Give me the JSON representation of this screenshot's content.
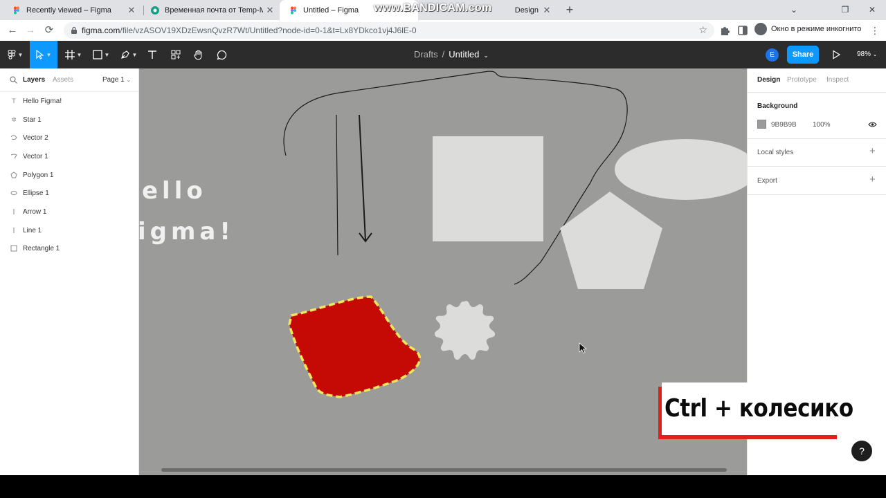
{
  "browser": {
    "tabs": [
      {
        "title": "Recently viewed – Figma",
        "active": false
      },
      {
        "title": "Временная почта от Temp-Mail",
        "active": false
      },
      {
        "title": "Untitled – Figma",
        "active": true
      },
      {
        "title": "Design",
        "active": false
      }
    ],
    "watermark": "www.BANDICAM.com",
    "url_host": "figma.com",
    "url_path": "/file/vzASOV19XDzEwsnQvzR7Wt/Untitled?node-id=0-1&t=Lx8YDkco1vj4J6lE-0",
    "incognito_label": "Окно в режиме инкогнито"
  },
  "figma": {
    "breadcrumb_parent": "Drafts",
    "file_name": "Untitled",
    "avatar_initial": "E",
    "share_label": "Share",
    "zoom_label": "98%"
  },
  "left_panel": {
    "tabs": [
      "Layers",
      "Assets"
    ],
    "page_label": "Page 1",
    "layers": [
      {
        "name": "Hello Figma!",
        "icon": "text-icon"
      },
      {
        "name": "Star 1",
        "icon": "star-icon"
      },
      {
        "name": "Vector 2",
        "icon": "vector-icon"
      },
      {
        "name": "Vector 1",
        "icon": "vector-icon"
      },
      {
        "name": "Polygon 1",
        "icon": "polygon-icon"
      },
      {
        "name": "Ellipse 1",
        "icon": "ellipse-icon"
      },
      {
        "name": "Arrow 1",
        "icon": "arrow-icon"
      },
      {
        "name": "Line 1",
        "icon": "line-icon"
      },
      {
        "name": "Rectangle 1",
        "icon": "rectangle-icon"
      }
    ]
  },
  "canvas": {
    "text_line1": "ello",
    "text_line2": "igma!",
    "background_color": "#9B9C99",
    "shape_color": "#DCDDDA",
    "selected_fill": "#C50A06",
    "selection_outline": "#F2E65A"
  },
  "right_panel": {
    "tabs": [
      "Design",
      "Prototype",
      "Inspect"
    ],
    "background_heading": "Background",
    "background_hex": "9B9B9B",
    "background_opacity": "100%",
    "local_styles_heading": "Local styles",
    "export_heading": "Export"
  },
  "caption": {
    "text": "Ctrl + колесико"
  },
  "help_label": "?"
}
